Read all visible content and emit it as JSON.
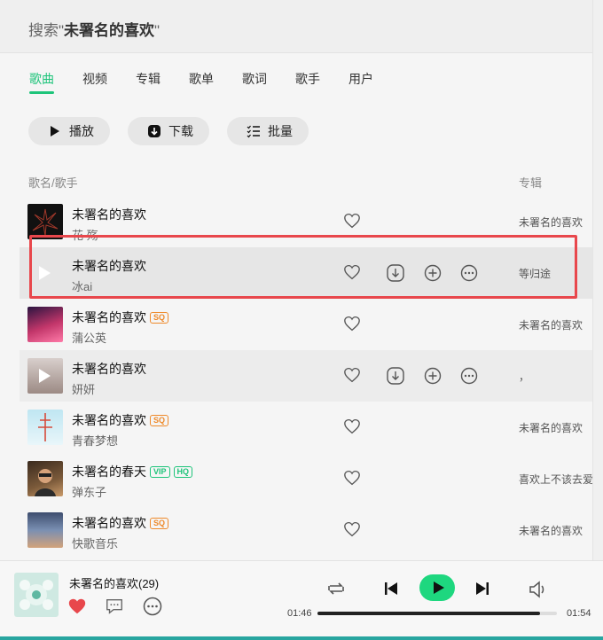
{
  "header": {
    "search_prefix": "搜索\"",
    "search_query": "未署名的喜欢",
    "search_suffix": "\""
  },
  "tabs": [
    {
      "label": "歌曲",
      "active": true
    },
    {
      "label": "视频"
    },
    {
      "label": "专辑"
    },
    {
      "label": "歌单"
    },
    {
      "label": "歌词"
    },
    {
      "label": "歌手"
    },
    {
      "label": "用户"
    }
  ],
  "actions": {
    "play": "播放",
    "download": "下载",
    "batch": "批量"
  },
  "columns": {
    "song": "歌名/歌手",
    "album": "专辑"
  },
  "songs": [
    {
      "title": "未署名的喜欢",
      "artist": "花 殇",
      "album": "未署名的喜欢",
      "badges": [],
      "cover_color": "#1a1a1a"
    },
    {
      "title": "未署名的喜欢",
      "artist": "冰ai",
      "album": "等归途",
      "badges": [],
      "cover_color": "#8a5a2e"
    },
    {
      "title": "未署名的喜欢",
      "artist": "蒲公英",
      "album": "未署名的喜欢",
      "badges": [
        "SQ"
      ],
      "cover_color": "#c2366a"
    },
    {
      "title": "未署名的喜欢",
      "artist": "妍妍",
      "album": "，",
      "badges": [],
      "cover_color": "#b9aba6"
    },
    {
      "title": "未署名的喜欢",
      "artist": "青春梦想",
      "album": "未署名的喜欢",
      "badges": [
        "SQ"
      ],
      "cover_color": "#9fd3e6"
    },
    {
      "title": "未署名的春天",
      "artist": "弹东子",
      "album": "喜欢上不该去爱的",
      "badges": [
        "VIP",
        "HQ"
      ],
      "cover_color": "#7b5a3a"
    },
    {
      "title": "未署名的喜欢",
      "artist": "快歌音乐",
      "album": "未署名的喜欢",
      "badges": [
        "SQ"
      ],
      "cover_color": "#5c6e8a"
    }
  ],
  "player": {
    "title": "未署名的喜欢(29)",
    "elapsed": "01:46",
    "total": "01:54",
    "progress": 0.93
  },
  "colors": {
    "accent": "#1ec47a",
    "play": "#1ed77f",
    "heart": "#e8474c",
    "highlight": "#e8474c"
  }
}
